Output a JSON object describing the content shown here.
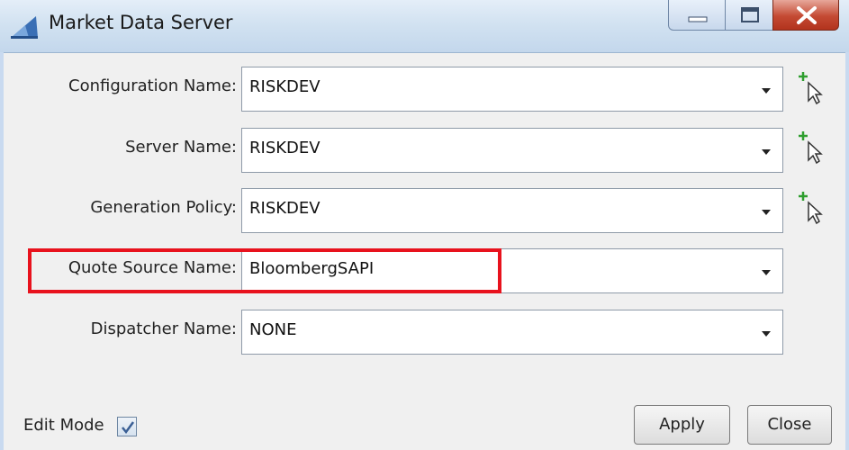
{
  "window": {
    "title": "Market Data Server",
    "icons": {
      "app": "app-icon",
      "minimize": "minimize-icon",
      "maximize": "maximize-icon",
      "close": "close-icon"
    }
  },
  "form": {
    "rows": [
      {
        "label": "Configuration Name:",
        "value": "RISKDEV",
        "has_picker": true
      },
      {
        "label": "Server Name:",
        "value": "RISKDEV",
        "has_picker": true
      },
      {
        "label": "Generation Policy:",
        "value": "RISKDEV",
        "has_picker": true
      },
      {
        "label": "Quote Source Name:",
        "value": "BloombergSAPI",
        "has_picker": false,
        "highlighted": true
      },
      {
        "label": "Dispatcher Name:",
        "value": "NONE",
        "has_picker": false
      }
    ],
    "dropdown_icon": "chevron-down-icon",
    "picker_icon": "add-cursor-icon"
  },
  "footer": {
    "edit_mode_label": "Edit Mode",
    "edit_mode_checked": true,
    "apply_label": "Apply",
    "close_label": "Close"
  },
  "colors": {
    "highlight": "#e8121d",
    "titlebar": "#d2e2f1",
    "close_button": "#c44a33",
    "picker_plus": "#2e9e2e"
  }
}
